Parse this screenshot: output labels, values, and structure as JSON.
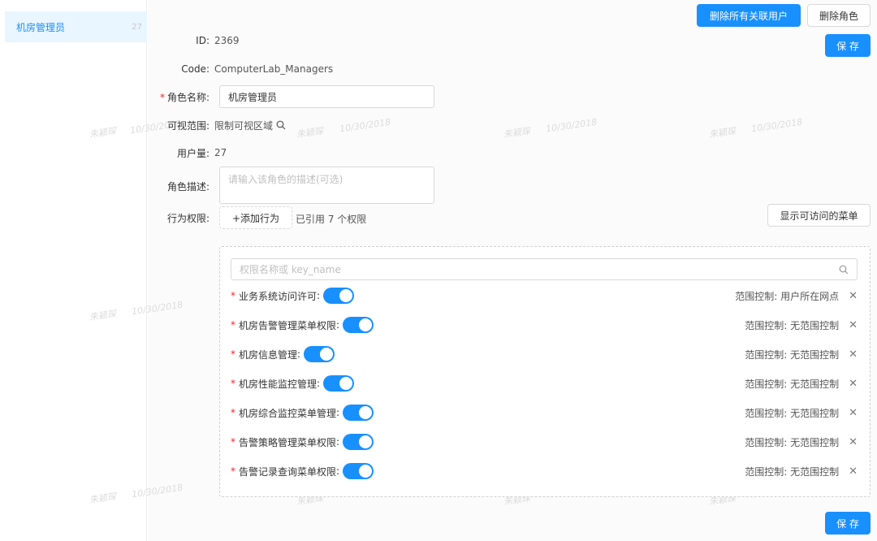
{
  "sidebar": {
    "items": [
      {
        "label": "机房管理员",
        "count": "27"
      }
    ]
  },
  "toolbar": {
    "delete_all_users": "删除所有关联用户",
    "delete_role": "删除角色",
    "save_top": "保 存",
    "save_bottom": "保 存"
  },
  "form": {
    "id_label": "ID",
    "id_value": "2369",
    "code_label": "Code",
    "code_value": "ComputerLab_Managers",
    "name_label": "角色名称",
    "name_value": "机房管理员",
    "scope_label": "可视范围",
    "scope_value": "限制可视区域",
    "user_count_label": "用户量",
    "user_count_value": "27",
    "desc_label": "角色描述",
    "desc_placeholder": "请输入该角色的描述(可选)",
    "perm_label": "行为权限",
    "add_action": "+添加行为",
    "perm_summary": "已引用 7 个权限",
    "show_menu": "显示可访问的菜单"
  },
  "permissions": {
    "search_placeholder": "权限名称或 key_name",
    "items": [
      {
        "name": "业务系统访问许可",
        "scope": "范围控制: 用户所在网点"
      },
      {
        "name": "机房告警管理菜单权限",
        "scope": "范围控制: 无范围控制"
      },
      {
        "name": "机房信息管理",
        "scope": "范围控制: 无范围控制"
      },
      {
        "name": "机房性能监控管理",
        "scope": "范围控制: 无范围控制"
      },
      {
        "name": "机房综合监控菜单管理",
        "scope": "范围控制: 无范围控制"
      },
      {
        "name": "告警策略管理菜单权限",
        "scope": "范围控制: 无范围控制"
      },
      {
        "name": "告警记录查询菜单权限",
        "scope": "范围控制: 无范围控制"
      }
    ]
  },
  "watermark": {
    "name": "朱颖琛",
    "date": "10/30/2018"
  },
  "colors": {
    "primary": "#1890ff",
    "required": "#f5222d"
  }
}
